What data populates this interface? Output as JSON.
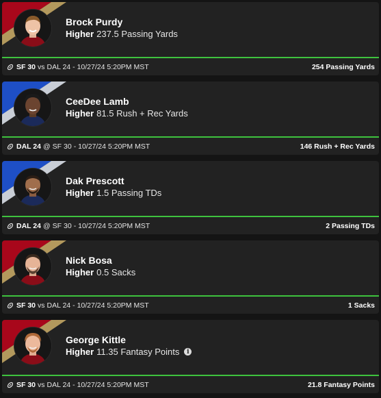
{
  "theme": {
    "card_bg": "#222222",
    "accent_green": "#3ec33e",
    "sf_red": "#a8071b",
    "sf_gold": "#b3995d",
    "dal_blue": "#1e4fc6",
    "dal_silver": "#c9ced6"
  },
  "cards": [
    {
      "player": "Brock Purdy",
      "direction": "Higher",
      "line": "237.5 Passing Yards",
      "team_colors": "sf",
      "info_icon": false,
      "game": {
        "team": "SF 30",
        "sep": "vs",
        "opponent": "DAL 24",
        "datetime": "- 10/27/24 5:20PM MST"
      },
      "result": "254 Passing Yards"
    },
    {
      "player": "CeeDee Lamb",
      "direction": "Higher",
      "line": "81.5 Rush + Rec Yards",
      "team_colors": "dal",
      "info_icon": false,
      "game": {
        "team": "DAL 24",
        "sep": "@",
        "opponent": "SF 30",
        "datetime": "- 10/27/24 5:20PM MST"
      },
      "result": "146 Rush + Rec Yards"
    },
    {
      "player": "Dak Prescott",
      "direction": "Higher",
      "line": "1.5 Passing TDs",
      "team_colors": "dal",
      "info_icon": false,
      "game": {
        "team": "DAL 24",
        "sep": "@",
        "opponent": "SF 30",
        "datetime": "- 10/27/24 5:20PM MST"
      },
      "result": "2 Passing TDs"
    },
    {
      "player": "Nick Bosa",
      "direction": "Higher",
      "line": "0.5 Sacks",
      "team_colors": "sf",
      "info_icon": false,
      "game": {
        "team": "SF 30",
        "sep": "vs",
        "opponent": "DAL 24",
        "datetime": "- 10/27/24 5:20PM MST"
      },
      "result": "1 Sacks"
    },
    {
      "player": "George Kittle",
      "direction": "Higher",
      "line": "11.35 Fantasy Points",
      "team_colors": "sf",
      "info_icon": true,
      "game": {
        "team": "SF 30",
        "sep": "vs",
        "opponent": "DAL 24",
        "datetime": "- 10/27/24 5:20PM MST"
      },
      "result": "21.8 Fantasy Points"
    }
  ]
}
